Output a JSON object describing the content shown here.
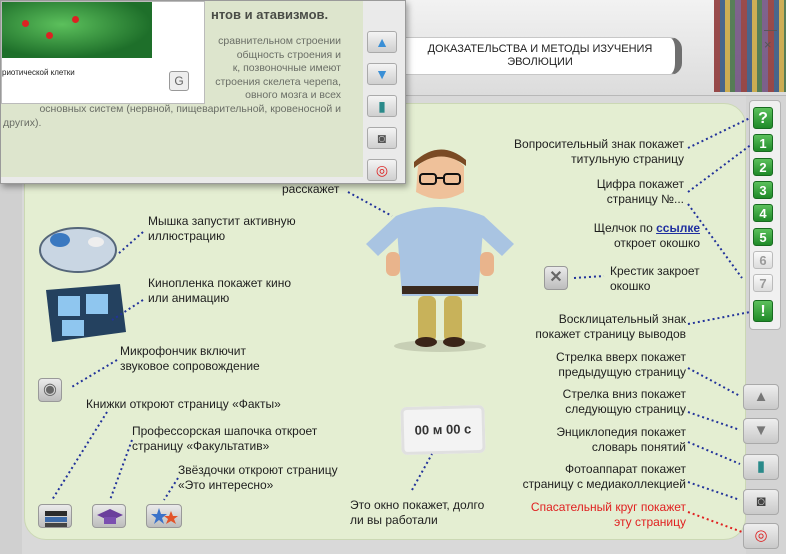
{
  "header": {
    "topic": "ДОКАЗАТЕЛЬСТВА И МЕТОДЫ ИЗУЧЕНИЯ ЭВОЛЮЦИИ",
    "close_glyph": "— ×"
  },
  "popup": {
    "heading": "нтов и атавизмов.",
    "image_caption": "риотической клетки",
    "paragraph_lines": [
      "сравнительном строении",
      "общность строения и",
      "к, позвоночные имеют",
      "строения скелета черепа,",
      "овного мозга и всех",
      "основных систем (нервной, пищеварительной, кровеносной и",
      "других)."
    ]
  },
  "labels": {
    "tells": "расскажет",
    "mouse": "Мышка запустит активную иллюстрацию",
    "film": "Кинопленка покажет кино или анимацию",
    "mic": "Микрофончик включит звуковое сопровождение",
    "books": "Книжки откроют страницу «Факты»",
    "cap": "Профессорская шапочка откроет страницу «Факультатив»",
    "stars": "Звёздочки откроют страницу «Это интересно»",
    "timer_note": "Это окно покажет, долго ли вы работали",
    "question": "Вопросительный знак покажет титульную страницу",
    "digit": "Цифра покажет страницу №...",
    "link_prefix": "Щелчок по",
    "link_word": "ссылке",
    "link_suffix": "откроет окошко",
    "cross": "Крестик закроет окошко",
    "exclaim": "Восклицательный знак покажет страницу выводов",
    "arrow_up": "Стрелка вверх покажет предыдущую страницу",
    "arrow_down": "Стрелка вниз покажет следующую страницу",
    "encyclopedia": "Энциклопедия покажет словарь понятий",
    "camera": "Фотоаппарат покажет страницу с медиаколлекцией",
    "lifebuoy": "Спасательный круг покажет эту страницу"
  },
  "timer": {
    "value": "00 м 00 с"
  },
  "nav": {
    "question": "?",
    "pages": [
      "1",
      "2",
      "3",
      "4",
      "5",
      "6",
      "7"
    ],
    "exclaim": "!"
  },
  "colors": {
    "accent_green": "#1f8a28",
    "red_label": "#e02020",
    "link_blue": "#1f2fa0"
  }
}
